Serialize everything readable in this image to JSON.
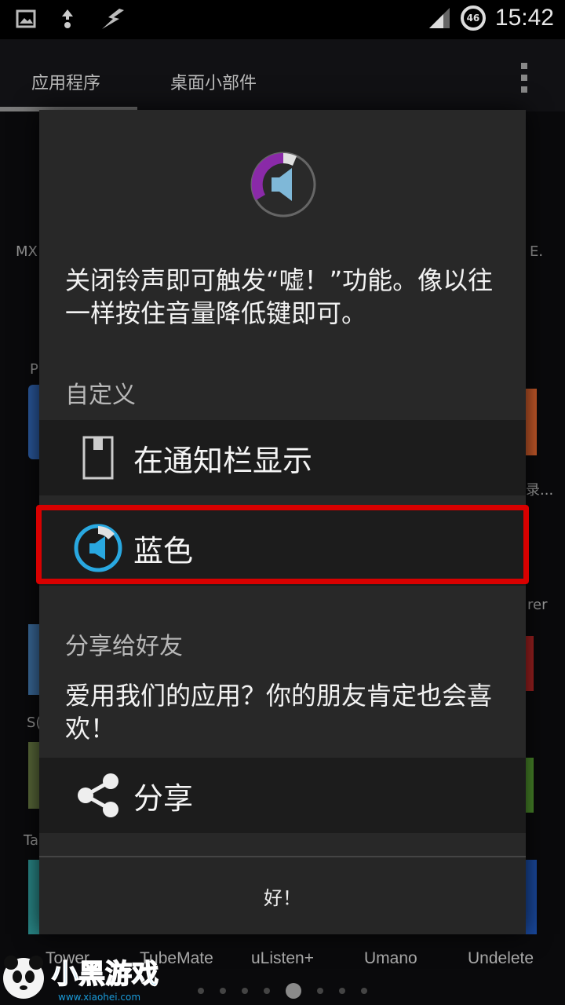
{
  "status_bar": {
    "time": "15:42",
    "battery_level": "46",
    "icons": [
      "image-icon",
      "data-transfer-icon",
      "flash-icon",
      "signal-icon"
    ]
  },
  "launcher": {
    "tabs": [
      "应用程序",
      "桌面小部件"
    ],
    "partial_labels": {
      "mx": "MX",
      "e": "E.",
      "p": "P",
      "lu": "录...",
      "rer": "rer",
      "sc": "S(",
      "ta": "Ta"
    },
    "bottom_apps": [
      "Tower",
      "TubeMate",
      "uListen+",
      "Umano",
      "Undelete"
    ]
  },
  "dialog": {
    "intro": "关闭铃声即可触发“嘘！”功能。像以往一样按住音量降低键即可。",
    "custom_section_title": "自定义",
    "options": [
      {
        "label": "在通知栏显示",
        "icon": "notification-icon"
      },
      {
        "label": "蓝色",
        "icon": "blue-theme-icon"
      }
    ],
    "share_section_title": "分享给好友",
    "share_description": "爱用我们的应用？你的朋友肯定也会喜欢！",
    "share_label": "分享",
    "ok_label": "好！"
  },
  "colors": {
    "accent_blue": "#29a8e0",
    "accent_purple": "#8a2aa8",
    "highlight_red": "#d80000"
  },
  "watermark": {
    "text": "小黑游戏",
    "url": "www.xiaohei.com"
  }
}
